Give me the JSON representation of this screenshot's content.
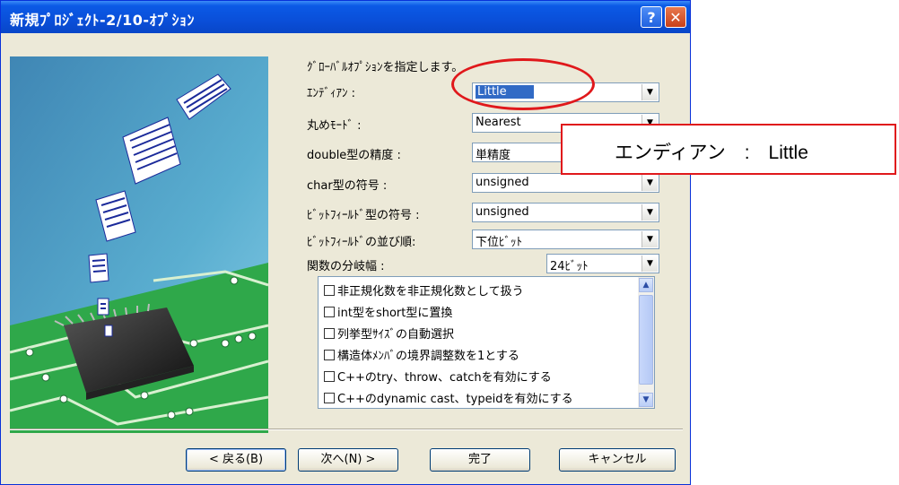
{
  "window": {
    "title": "新規ﾌﾟﾛｼﾞｪｸﾄ-2/10-ｵﾌﾟｼｮﾝ",
    "help_glyph": "?",
    "close_glyph": "✕"
  },
  "heading": "ｸﾞﾛｰﾊﾞﾙｵﾌﾟｼｮﾝを指定します。",
  "fields": [
    {
      "label": "ｴﾝﾃﾞｨｱﾝ :",
      "value": "Little"
    },
    {
      "label": "丸めﾓｰﾄﾞ :",
      "value": "Nearest"
    },
    {
      "label": "double型の精度 :",
      "value": "単精度"
    },
    {
      "label": "char型の符号 :",
      "value": "unsigned"
    },
    {
      "label": "ﾋﾞｯﾄﾌｨｰﾙﾄﾞ型の符号 :",
      "value": "unsigned"
    },
    {
      "label": "ﾋﾞｯﾄﾌｨｰﾙﾄﾞの並び順:",
      "value": "下位ﾋﾞｯﾄ"
    },
    {
      "label": "関数の分岐幅 :",
      "value": "24ﾋﾞｯﾄ"
    }
  ],
  "dropdown_arrow": "▼",
  "options": [
    "非正規化数を非正規化数として扱う",
    "int型をshort型に置換",
    "列挙型ｻｲｽﾞの自動選択",
    "構造体ﾒﾝﾊﾞの境界調整数を1とする",
    "C++のtry、throw、catchを有効にする",
    "C++のdynamic cast、typeidを有効にする"
  ],
  "scroll": {
    "up": "▲",
    "down": "▼"
  },
  "buttons": {
    "back": "< 戻る(B)",
    "next": "次へ(N) >",
    "finish": "完了",
    "cancel": "キャンセル"
  },
  "annotation": {
    "text": "エンディアン　:　Little",
    "color": "#e0181b"
  },
  "colors": {
    "title_bar": "#0a4fd9",
    "selection": "#316ac5",
    "board": "#2fa84a"
  }
}
